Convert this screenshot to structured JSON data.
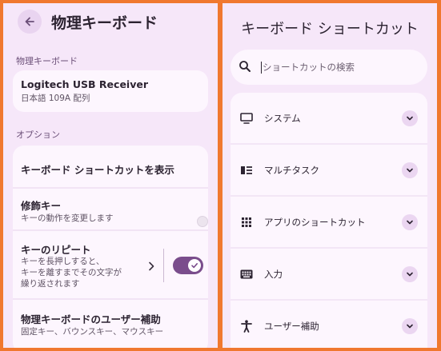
{
  "left": {
    "title": "物理キーボード",
    "keyboard_section_label": "物理キーボード",
    "device": {
      "name": "Logitech USB Receiver",
      "layout": "日本語 109A 配列"
    },
    "options_section_label": "オプション",
    "options": {
      "shortcuts": "キーボード ショートカットを表示",
      "modifier_title": "修飾キー",
      "modifier_sub": "キーの動作を変更します",
      "repeat_title": "キーのリピート",
      "repeat_sub_1": "キーを長押しすると、",
      "repeat_sub_2": "キーを離すまでその文字が",
      "repeat_sub_3": "繰り返されます",
      "repeat_enabled": true,
      "a11y_title": "物理キーボードのユーザー補助",
      "a11y_sub": "固定キー、バウンスキー、マウスキー"
    }
  },
  "right": {
    "title": "キーボード ショートカット",
    "search_placeholder": "ショートカットの検索",
    "categories": [
      {
        "label": "システム",
        "icon": "monitor-icon"
      },
      {
        "label": "マルチタスク",
        "icon": "multitask-icon"
      },
      {
        "label": "アプリのショートカット",
        "icon": "apps-grid-icon"
      },
      {
        "label": "入力",
        "icon": "keyboard-icon"
      },
      {
        "label": "ユーザー補助",
        "icon": "accessibility-icon"
      }
    ]
  },
  "colors": {
    "frame": "#f0782f",
    "panel_bg": "#f6e7f9",
    "card_bg": "#fdf6fe",
    "accent": "#7a4d8c"
  }
}
